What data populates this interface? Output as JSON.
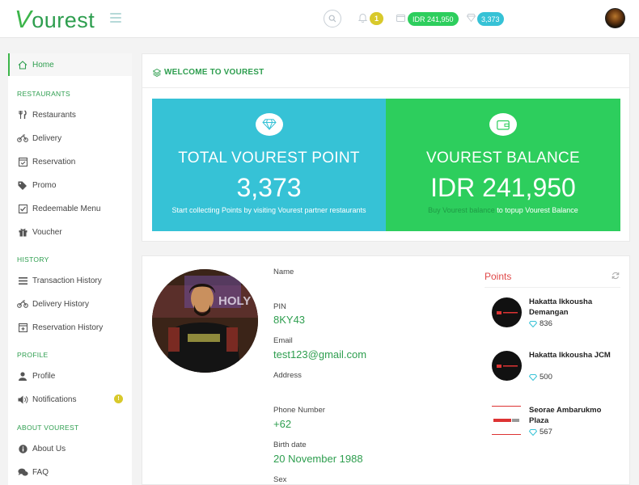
{
  "header": {
    "logo_text": "ourest",
    "logo_v": "V",
    "notification_count": "1",
    "balance": "IDR 241,950",
    "points": "3,373"
  },
  "sidebar": {
    "home": "Home",
    "sections": {
      "restaurants": "RESTAURANTS",
      "history": "HISTORY",
      "profile": "PROFILE",
      "about": "ABOUT VOUREST"
    },
    "items": {
      "restaurants": "Restaurants",
      "delivery": "Delivery",
      "reservation": "Reservation",
      "promo": "Promo",
      "redeemable_menu": "Redeemable Menu",
      "voucher": "Voucher",
      "transaction_history": "Transaction History",
      "delivery_history": "Delivery History",
      "reservation_history": "Reservation History",
      "profile": "Profile",
      "notifications": "Notifications",
      "about_us": "About Us",
      "faq": "FAQ"
    },
    "notifications_badge": "!"
  },
  "welcome": {
    "title": "WELCOME TO VOUREST",
    "points_box": {
      "title": "TOTAL VOUREST POINT",
      "value": "3,373",
      "subtitle": "Start collecting Points by visiting Vourest partner restaurants"
    },
    "balance_box": {
      "title": "VOUREST BALANCE",
      "value": "IDR 241,950",
      "subtitle_muted": "Buy Vourest balance",
      "subtitle_rest": " to topup Vourest Balance"
    }
  },
  "profile": {
    "fields": {
      "name_label": "Name",
      "name_value": "",
      "pin_label": "PIN",
      "pin_value": "8KY43",
      "email_label": "Email",
      "email_value": "test123@gmail.com",
      "address_label": "Address",
      "address_value": "",
      "phone_label": "Phone Number",
      "phone_value": "+62",
      "birth_label": "Birth date",
      "birth_value": "20 November 1988",
      "sex_label": "Sex"
    },
    "points": {
      "title": "Points",
      "restaurants": [
        {
          "name": "Hakatta Ikkousha Demangan",
          "points": "836"
        },
        {
          "name": "Hakatta Ikkousha JCM",
          "points": "500"
        },
        {
          "name": "Seorae Ambarukmo Plaza",
          "points": "567"
        }
      ]
    }
  },
  "colors": {
    "brand_green": "#2e9e4f",
    "points_blue": "#36c2d6",
    "balance_green": "#2dce5d",
    "badge_yellow": "#d8c92b",
    "points_red": "#e04848"
  }
}
